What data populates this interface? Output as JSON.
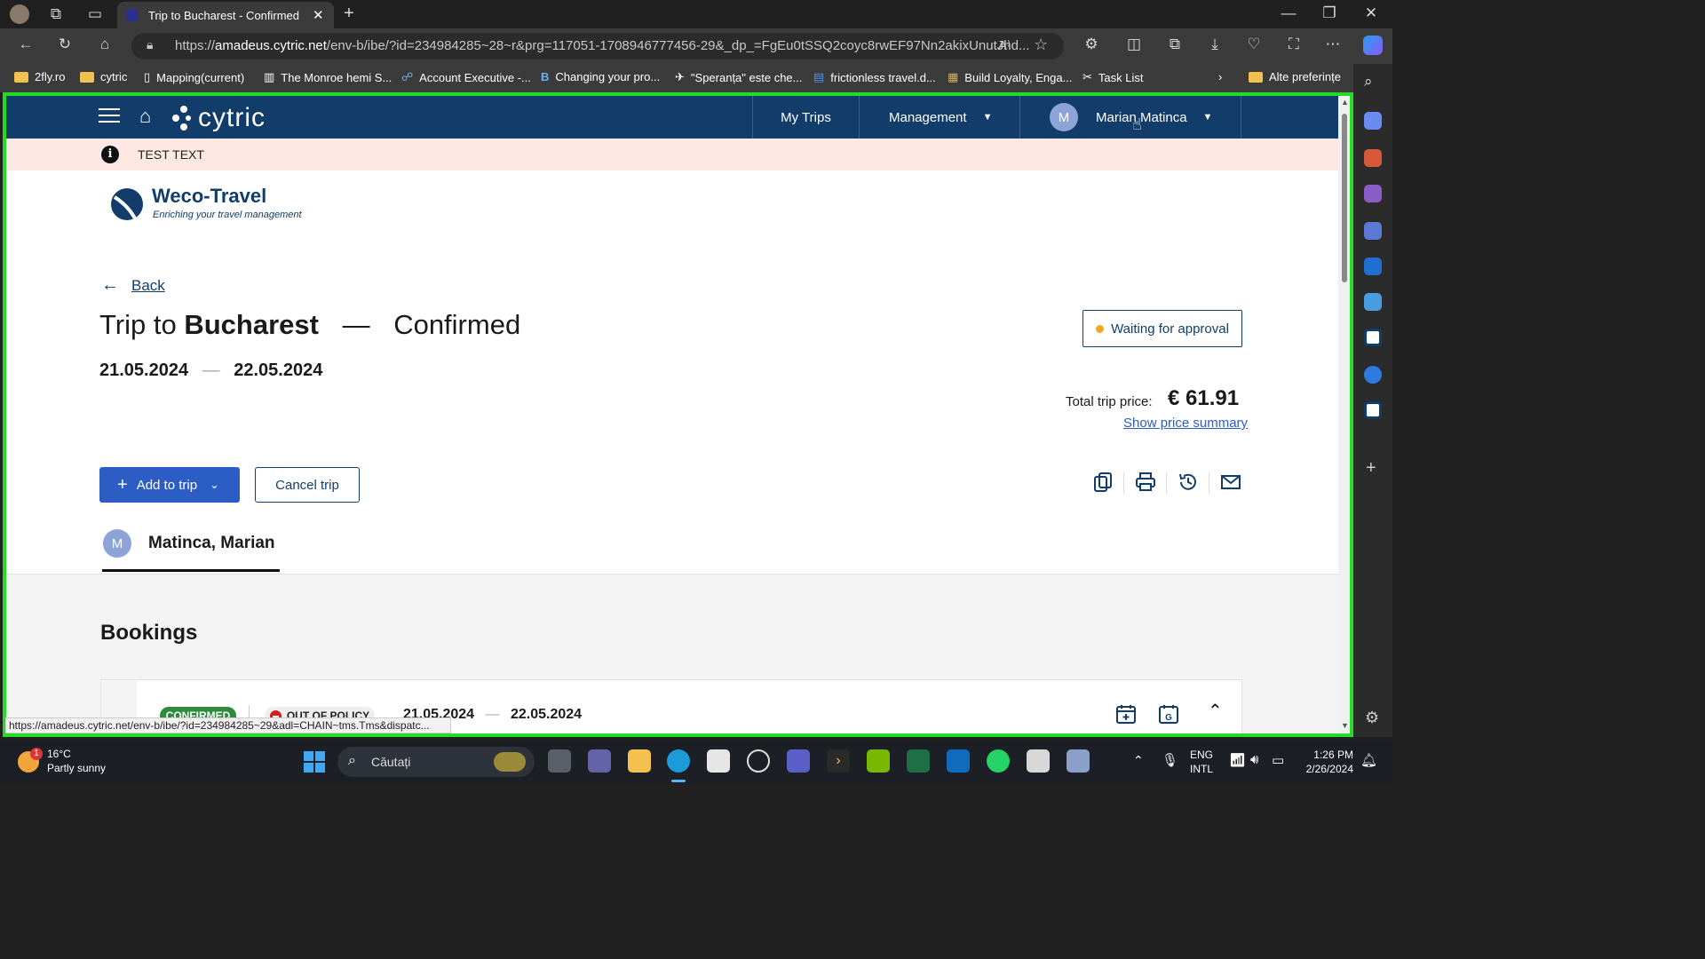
{
  "browser": {
    "tab_title": "Trip to Bucharest - Confirmed",
    "url_prefix": "https://",
    "url_host": "amadeus.cytric.net",
    "url_rest": "/env-b/ibe/?id=234984285~28~r&prg=117051-1708946777456-29&_dp_=FgEu0tSSQ2coyc8rwEF97Nn2akixUnutJhd...",
    "bookmarks": [
      "2fly.ro",
      "cytric",
      "Mapping(current)",
      "The Monroe hemi S...",
      "Account Executive -...",
      "Changing your pro...",
      "\"Speranța\" este che...",
      "frictionless travel.d...",
      "Build Loyalty, Enga...",
      "Task List"
    ],
    "other_bookmarks": "Alte preferințe",
    "status_url": "https://amadeus.cytric.net/env-b/ibe/?id=234984285~29&adl=CHAIN~tms.Tms&dispatc..."
  },
  "app": {
    "logo": "cytric",
    "nav": {
      "my_trips": "My Trips",
      "management": "Management",
      "user_initial": "M",
      "user_name": "Marian Matinca"
    },
    "banner_text": "TEST TEXT",
    "company_name": "Weco-Travel",
    "company_tagline": "Enriching your travel management"
  },
  "trip": {
    "back_label": "Back",
    "title_prefix": "Trip to",
    "destination": "Bucharest",
    "separator": "—",
    "status": "Confirmed",
    "date_start": "21.05.2024",
    "date_end": "22.05.2024",
    "date_sep": "—",
    "approval_status": "Waiting for approval",
    "price_label": "Total trip price:",
    "price_value": "€ 61.91",
    "price_summary_link": "Show price summary",
    "add_to_trip": "Add to trip",
    "cancel_trip": "Cancel trip",
    "traveler_initial": "M",
    "traveler_name": "Matinca, Marian"
  },
  "bookings": {
    "heading": "Bookings",
    "status_badge": "CONFIRMED",
    "policy_badge": "OUT OF POLICY",
    "date_start": "21.05.2024",
    "date_end": "22.05.2024",
    "date_sep": "—"
  },
  "taskbar": {
    "weather_temp": "16°C",
    "weather_desc": "Partly sunny",
    "weather_alert": "1",
    "search_placeholder": "Căutați",
    "lang_top": "ENG",
    "lang_bottom": "INTL",
    "time": "1:26 PM",
    "date": "2/26/2024"
  },
  "colors": {
    "header_bg": "#123d6b",
    "primary_button": "#2b5dc5",
    "banner_bg": "#fde8e4",
    "approval_dot": "#f5a623",
    "confirmed_badge": "#2e8b3e",
    "focus_outline": "#22dd22"
  }
}
